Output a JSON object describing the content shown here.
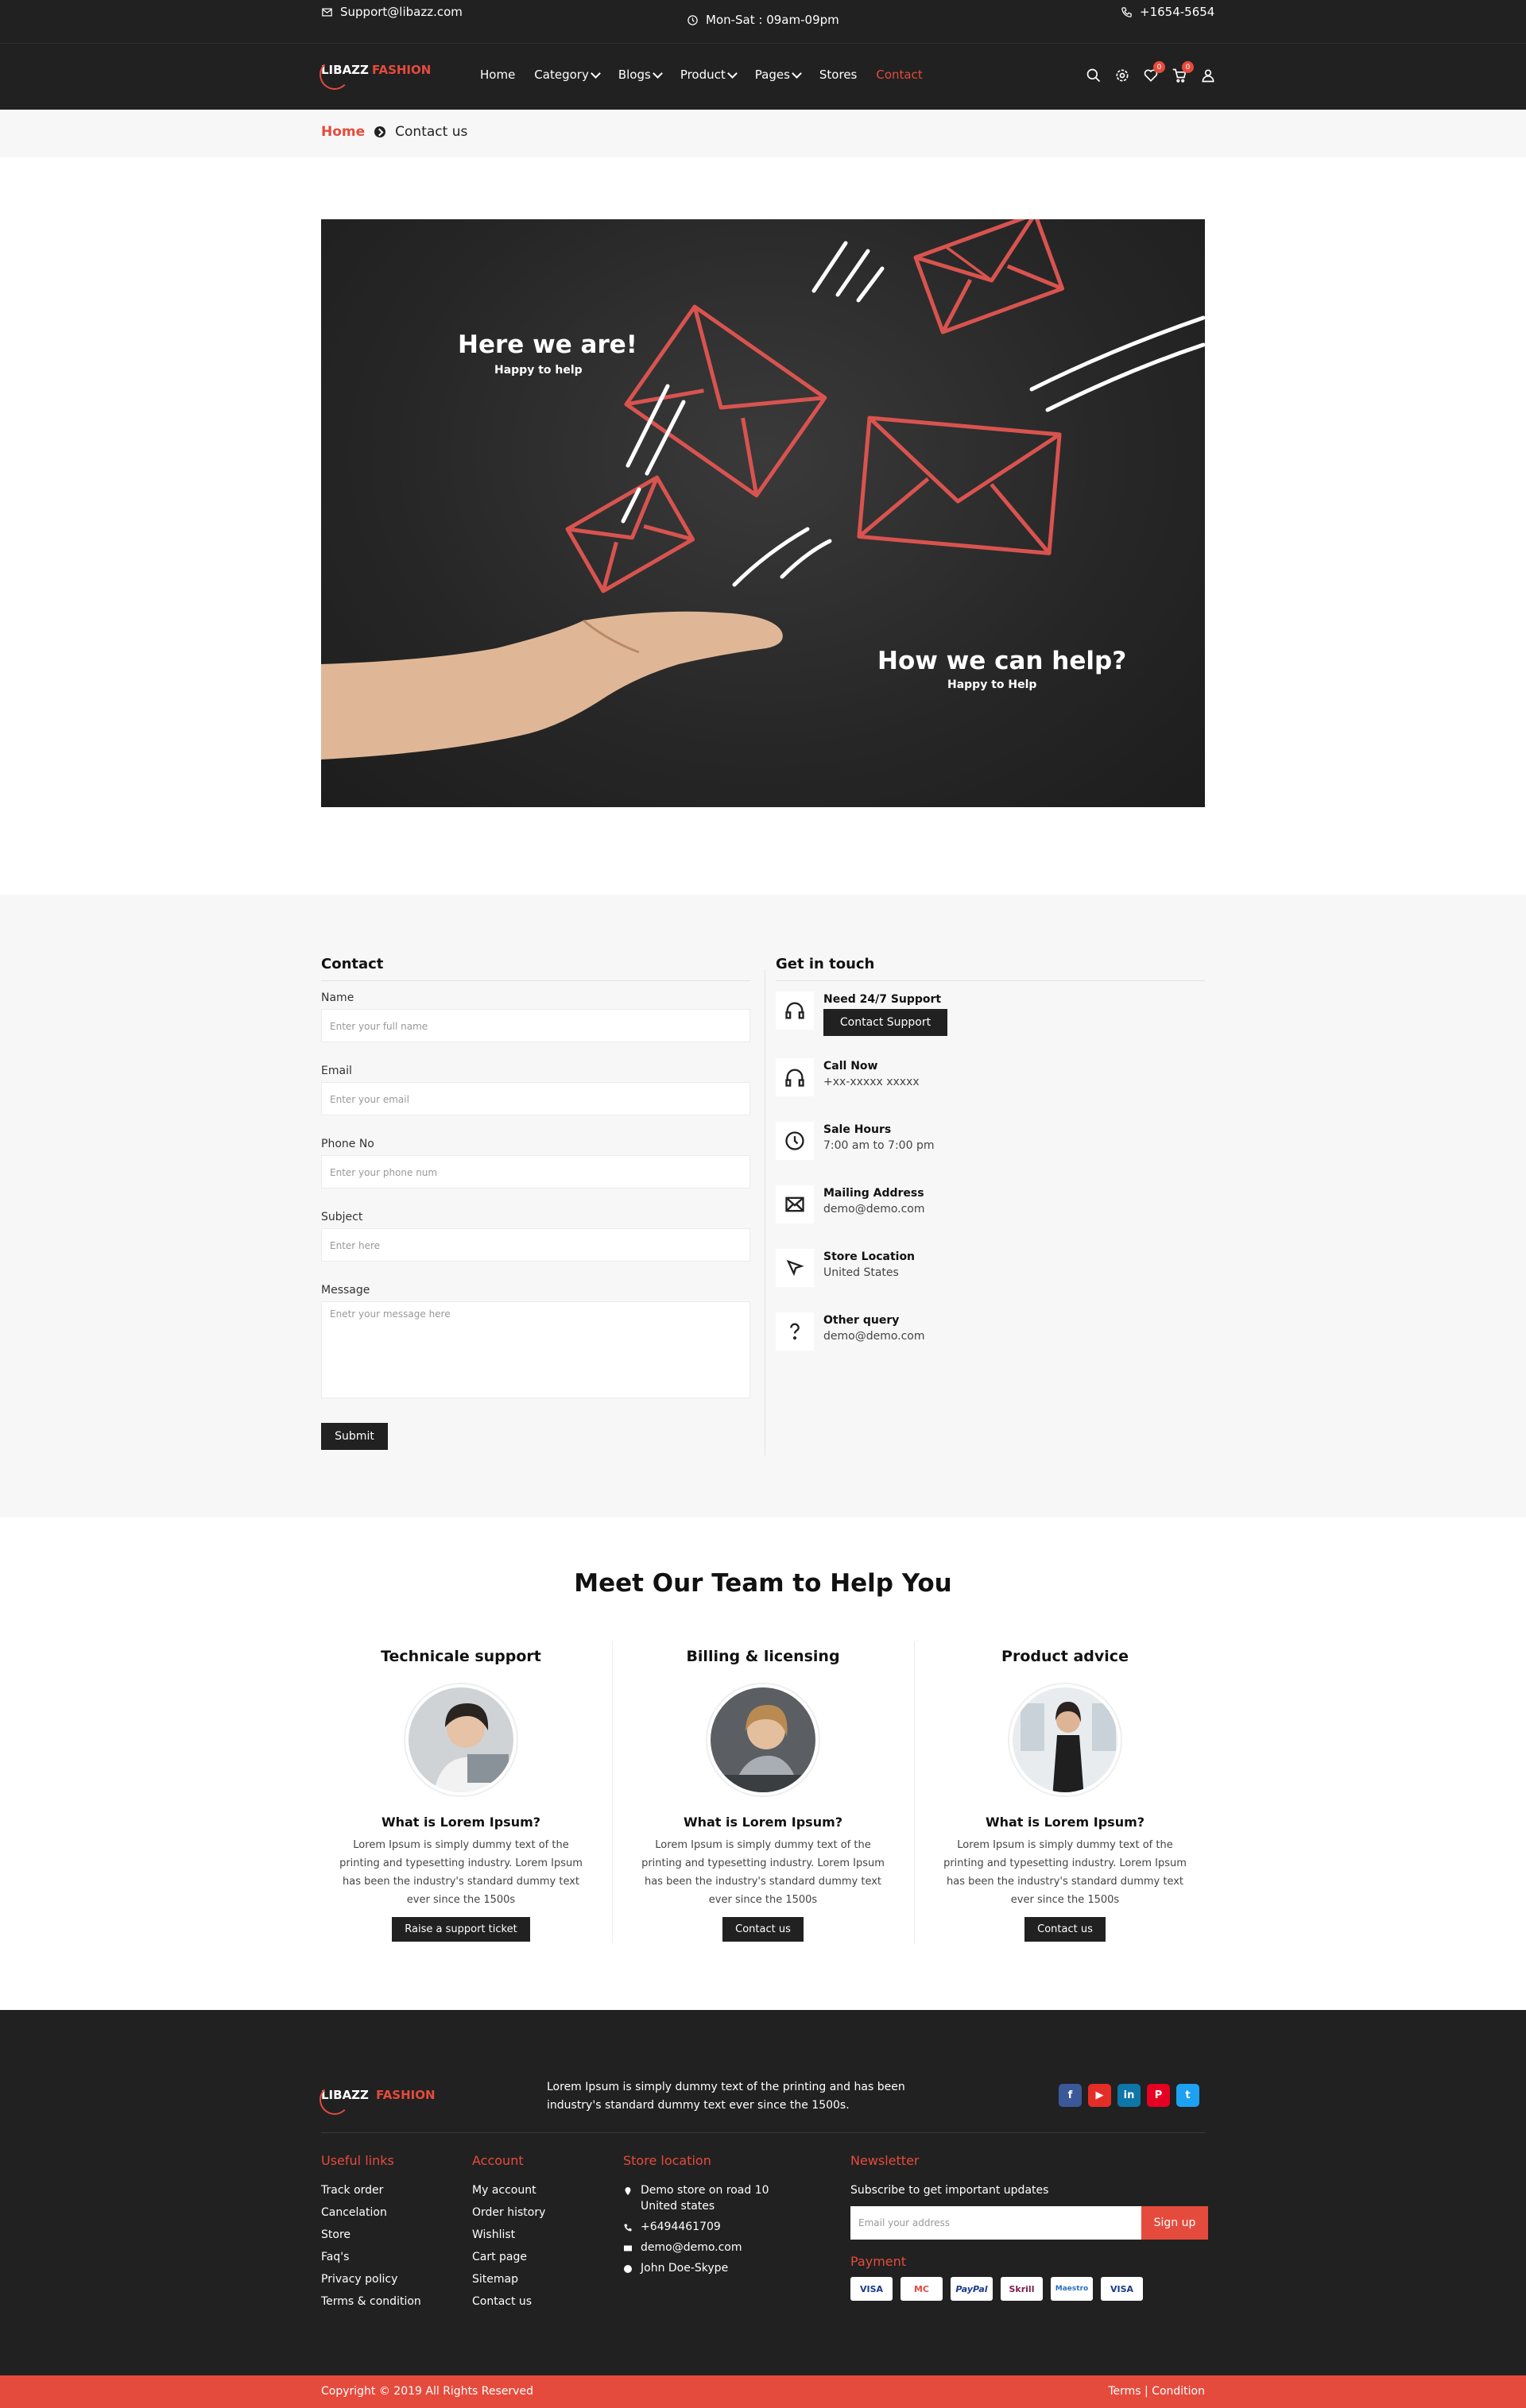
{
  "topbar": {
    "email": "Support@libazz.com",
    "hours": "Mon-Sat : 09am-09pm",
    "phone": "+1654-5654"
  },
  "brand": {
    "part1": "LIBAZZ",
    "part2": "FASHION",
    "accent": "#e54b3c",
    "dark": "#212121"
  },
  "nav": {
    "items": [
      {
        "label": "Home"
      },
      {
        "label": "Category"
      },
      {
        "label": "Blogs"
      },
      {
        "label": "Product"
      },
      {
        "label": "Pages"
      },
      {
        "label": "Stores"
      },
      {
        "label": "Contact"
      }
    ],
    "icons": [
      "search-icon",
      "settings-icon",
      "heart-icon",
      "cart-icon",
      "user-icon"
    ],
    "wishlist_count": "0",
    "cart_count": "0"
  },
  "breadcrumb": {
    "home": "Home",
    "current": "Contact us"
  },
  "hero": {
    "title1": "Here we are!",
    "sub1": "Happy to help",
    "title2": "How we can help?",
    "sub2": "Happy to Help"
  },
  "contact_form": {
    "heading": "Contact",
    "fields": [
      {
        "label": "Name",
        "placeholder": "Enter your full name"
      },
      {
        "label": "Email",
        "placeholder": "Enter your email"
      },
      {
        "label": "Phone No",
        "placeholder": "Enter your phone num"
      },
      {
        "label": "Subject",
        "placeholder": "Enter here"
      },
      {
        "label": "Message",
        "placeholder": "Enetr your message here"
      }
    ],
    "submit": "Submit"
  },
  "get_in_touch": {
    "heading": "Get in touch",
    "items": [
      {
        "title": "Need 24/7 Support",
        "button": "Contact Support",
        "icon": "headset-icon"
      },
      {
        "title": "Call Now",
        "value": "+xx-xxxxx xxxxx",
        "icon": "headphones-icon"
      },
      {
        "title": "Sale Hours",
        "value": "7:00 am to 7:00 pm",
        "icon": "clock-icon"
      },
      {
        "title": "Mailing Address",
        "value": "demo@demo.com",
        "icon": "mail-icon"
      },
      {
        "title": "Store Location",
        "value": "United States",
        "icon": "cursor-icon"
      },
      {
        "title": "Other query",
        "value": "demo@demo.com",
        "icon": "question-icon"
      }
    ]
  },
  "team": {
    "title": "Meet Our Team to Help You",
    "cards": [
      {
        "title": "Technicale support",
        "question": "What is Lorem Ipsum?",
        "desc": "Lorem Ipsum is simply dummy text of the printing and typesetting industry. Lorem Ipsum has been the industry's standard dummy text ever since the 1500s",
        "button": "Raise a support ticket"
      },
      {
        "title": "Billing & licensing",
        "question": "What is Lorem Ipsum?",
        "desc": "Lorem Ipsum is simply dummy text of the printing and typesetting industry. Lorem Ipsum has been the industry's standard dummy text ever since the 1500s",
        "button": "Contact us"
      },
      {
        "title": "Product advice",
        "question": "What is Lorem Ipsum?",
        "desc": "Lorem Ipsum is simply dummy text of the printing and typesetting industry. Lorem Ipsum has been the industry's standard dummy text ever since the 1500s",
        "button": "Contact us"
      }
    ]
  },
  "footer": {
    "about": "Lorem Ipsum is simply dummy text of the printing and has been industry's standard dummy text ever since the 1500s.",
    "social": [
      "f",
      "▶",
      "in",
      "P",
      "t"
    ],
    "useful_links": {
      "heading": "Useful links",
      "items": [
        "Track order",
        "Cancelation",
        "Store",
        "Faq's",
        "Privacy policy",
        "Terms & condition"
      ]
    },
    "account": {
      "heading": "Account",
      "items": [
        "My account",
        "Order history",
        "Wishlist",
        "Cart page",
        "Sitemap",
        "Contact us"
      ]
    },
    "store": {
      "heading": "Store location",
      "address1": "Demo store on road 10",
      "address2": "United states",
      "phone": "+6494461709",
      "email": "demo@demo.com",
      "skype": "John Doe-Skype"
    },
    "newsletter": {
      "heading": "Newsletter",
      "text": "Subscribe to get important updates",
      "placeholder": "Email your address",
      "button": "Sign up"
    },
    "payment": {
      "heading": "Payment",
      "items": [
        "VISA",
        "MC",
        "PayPal",
        "Skrill",
        "Maestro",
        "VISA"
      ]
    },
    "copyright": "Copyright © 2019 All Rights Reserved",
    "terms": "Terms | Condition"
  }
}
